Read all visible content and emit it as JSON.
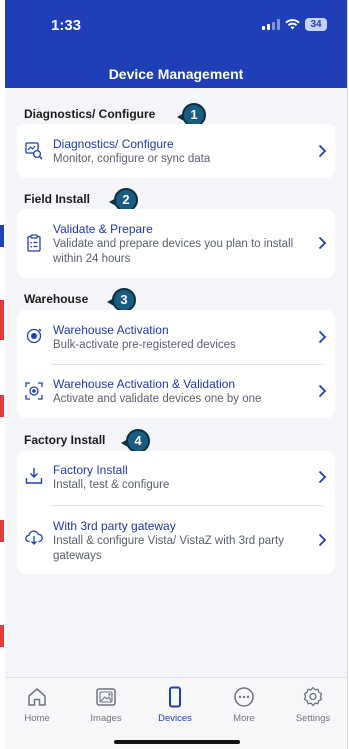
{
  "status_bar": {
    "time": "1:33",
    "battery": "34"
  },
  "header": {
    "title": "Device Management"
  },
  "sections": [
    {
      "title": "Diagnostics/ Configure",
      "badge": "1",
      "items": [
        {
          "icon": "diagnostics-icon",
          "title": "Diagnostics/ Configure",
          "subtitle": "Monitor, configure or sync data"
        }
      ]
    },
    {
      "title": "Field Install",
      "badge": "2",
      "items": [
        {
          "icon": "clipboard-checklist-icon",
          "title": "Validate & Prepare",
          "subtitle": "Validate and prepare devices you plan to install within 24 hours"
        }
      ]
    },
    {
      "title": "Warehouse",
      "badge": "3",
      "items": [
        {
          "icon": "target-activation-icon",
          "title": "Warehouse Activation",
          "subtitle": "Bulk-activate pre-registered devices"
        },
        {
          "icon": "scan-target-icon",
          "title": "Warehouse Activation & Validation",
          "subtitle": "Activate and validate devices one by one"
        }
      ]
    },
    {
      "title": "Factory Install",
      "badge": "4",
      "items": [
        {
          "icon": "download-tray-icon",
          "title": "Factory Install",
          "subtitle": "Install, test & configure"
        },
        {
          "icon": "cloud-download-icon",
          "title": "With 3rd party gateway",
          "subtitle": "Install & configure Vista/ VistaZ with 3rd party gateways"
        }
      ]
    }
  ],
  "tab_bar": {
    "active": "Devices",
    "tabs": [
      {
        "label": "Home",
        "icon": "home-icon"
      },
      {
        "label": "Images",
        "icon": "images-icon"
      },
      {
        "label": "Devices",
        "icon": "device-icon"
      },
      {
        "label": "More",
        "icon": "more-icon"
      },
      {
        "label": "Settings",
        "icon": "settings-icon"
      }
    ]
  },
  "colors": {
    "header": "#1f3fb8",
    "link": "#1d3aa8",
    "badge": "#1a5d82",
    "background": "#f4f5f8"
  }
}
